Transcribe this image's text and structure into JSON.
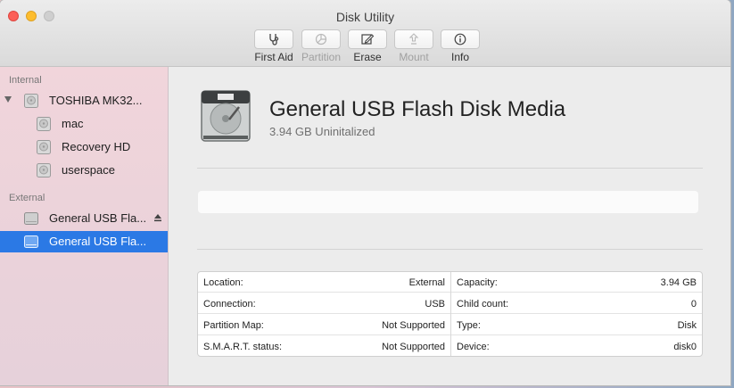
{
  "window": {
    "title": "Disk Utility"
  },
  "toolbar": {
    "items": [
      {
        "label": "First Aid",
        "icon": "stethoscope-icon",
        "enabled": true
      },
      {
        "label": "Partition",
        "icon": "pie-icon",
        "enabled": false
      },
      {
        "label": "Erase",
        "icon": "erase-icon",
        "enabled": true
      },
      {
        "label": "Mount",
        "icon": "mount-icon",
        "enabled": false
      },
      {
        "label": "Info",
        "icon": "info-icon",
        "enabled": true
      }
    ]
  },
  "sidebar": {
    "internal_label": "Internal",
    "external_label": "External",
    "internal_disk": "TOSHIBA MK32...",
    "volumes": [
      "mac",
      "Recovery HD",
      "userspace"
    ],
    "external": [
      {
        "label": "General USB Fla...",
        "selected": false
      },
      {
        "label": "General USB Fla...",
        "selected": true
      }
    ],
    "selection_color": "#2b79e5"
  },
  "detail": {
    "title": "General USB Flash Disk Media",
    "subtitle": "3.94 GB Uninitalized",
    "left_rows": [
      {
        "key": "Location:",
        "value": "External"
      },
      {
        "key": "Connection:",
        "value": "USB"
      },
      {
        "key": "Partition Map:",
        "value": "Not Supported"
      },
      {
        "key": "S.M.A.R.T. status:",
        "value": "Not Supported"
      }
    ],
    "right_rows": [
      {
        "key": "Capacity:",
        "value": "3.94 GB"
      },
      {
        "key": "Child count:",
        "value": "0"
      },
      {
        "key": "Type:",
        "value": "Disk"
      },
      {
        "key": "Device:",
        "value": "disk0"
      }
    ]
  }
}
